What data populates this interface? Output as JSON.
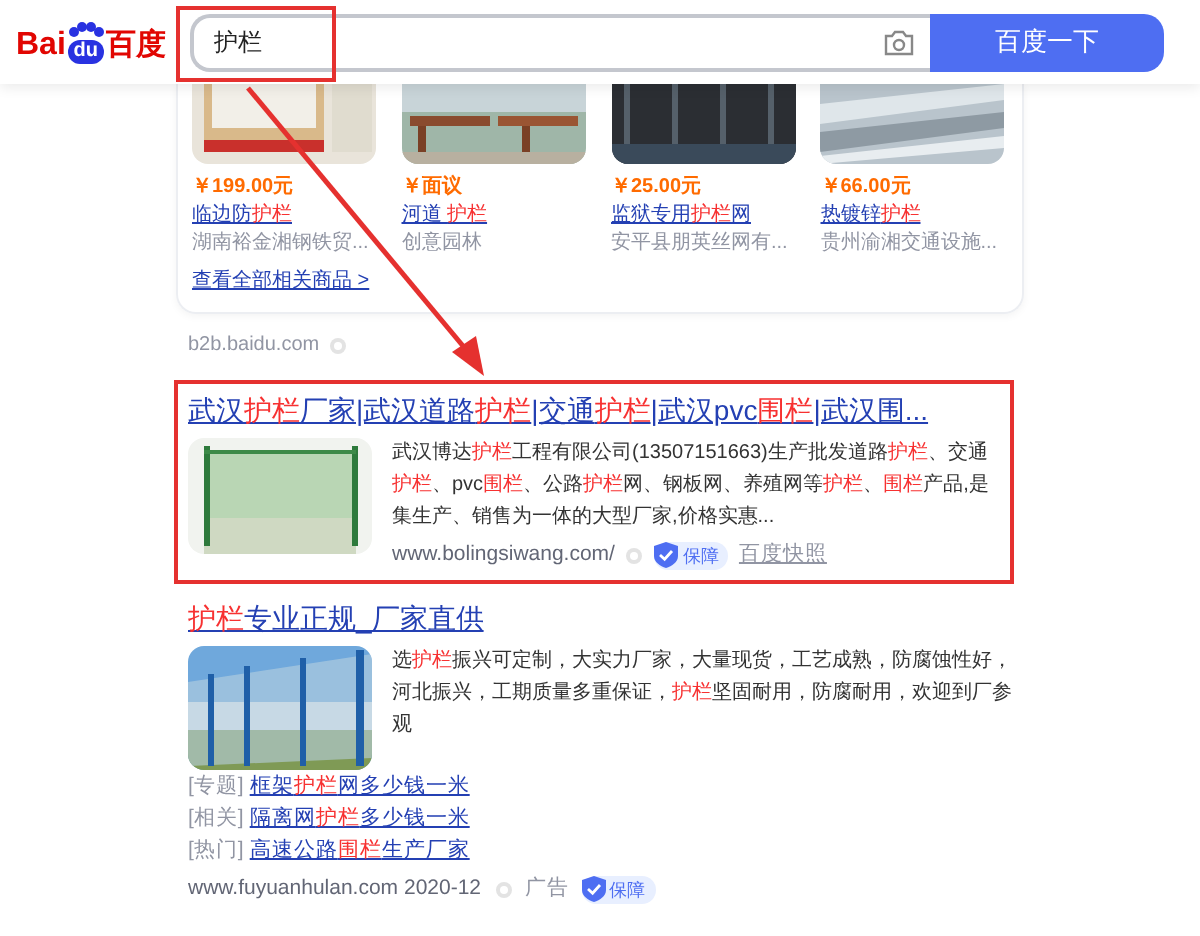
{
  "header": {
    "logo": {
      "latin": "Bai",
      "paw": "du",
      "chinese": "百度"
    },
    "search": {
      "value": "护栏"
    },
    "search_button": "百度一下"
  },
  "products": {
    "items": [
      {
        "price": "￥199.00元",
        "title": [
          {
            "text": "临边防",
            "highlight": false
          },
          {
            "text": "护栏",
            "highlight": true
          }
        ],
        "shop": "湖南裕金湘钢铁贸..."
      },
      {
        "price": "￥面议",
        "title": [
          {
            "text": "河道 ",
            "highlight": false
          },
          {
            "text": "护栏",
            "highlight": true
          }
        ],
        "shop": "创意园林"
      },
      {
        "price": "￥25.00元",
        "title": [
          {
            "text": "监狱专用",
            "highlight": false
          },
          {
            "text": "护栏",
            "highlight": true
          },
          {
            "text": "网",
            "highlight": false
          }
        ],
        "shop": "安平县朋英丝网有..."
      },
      {
        "price": "￥66.00元",
        "title": [
          {
            "text": "热镀锌",
            "highlight": false
          },
          {
            "text": "护栏",
            "highlight": true
          }
        ],
        "shop": "贵州渝湘交通设施..."
      }
    ],
    "more_link": "查看全部相关商品 >",
    "source": "b2b.baidu.com"
  },
  "results": [
    {
      "title": [
        {
          "text": "武汉",
          "highlight": false
        },
        {
          "text": "护栏",
          "highlight": true
        },
        {
          "text": "厂家|武汉道路",
          "highlight": false
        },
        {
          "text": "护栏",
          "highlight": true
        },
        {
          "text": "|交通",
          "highlight": false
        },
        {
          "text": "护栏",
          "highlight": true
        },
        {
          "text": "|武汉pvc",
          "highlight": false
        },
        {
          "text": "围栏",
          "highlight": true
        },
        {
          "text": "|武汉围...",
          "highlight": false
        }
      ],
      "description": [
        {
          "text": "武汉博达",
          "highlight": false
        },
        {
          "text": "护栏",
          "highlight": true
        },
        {
          "text": "工程有限公司(13507151663)生产批发道路",
          "highlight": false
        },
        {
          "text": "护栏",
          "highlight": true
        },
        {
          "text": "、交通",
          "highlight": false
        },
        {
          "text": "护栏",
          "highlight": true
        },
        {
          "text": "、pvc",
          "highlight": false
        },
        {
          "text": "围栏",
          "highlight": true
        },
        {
          "text": "、公路",
          "highlight": false
        },
        {
          "text": "护栏",
          "highlight": true
        },
        {
          "text": "网、钢板网、养殖网等",
          "highlight": false
        },
        {
          "text": "护栏",
          "highlight": true
        },
        {
          "text": "、",
          "highlight": false
        },
        {
          "text": "围栏",
          "highlight": true
        },
        {
          "text": "产品,是集生产、销售为一体的大型厂家,价格实惠...",
          "highlight": false
        }
      ],
      "url": "www.bolingsiwang.com/",
      "badge": "保障",
      "snapshot": "百度快照",
      "annotated": true
    },
    {
      "title": [
        {
          "text": "护栏",
          "highlight": true
        },
        {
          "text": "专业正规_厂家直供",
          "highlight": false
        }
      ],
      "description": [
        {
          "text": "选",
          "highlight": false
        },
        {
          "text": "护栏",
          "highlight": true
        },
        {
          "text": "振兴可定制，大实力厂家，大量现货，工艺成熟，防腐蚀性好，河北振兴，工期质量多重保证，",
          "highlight": false
        },
        {
          "text": "护栏",
          "highlight": true
        },
        {
          "text": "坚固耐用，防腐耐用，欢迎到厂参观",
          "highlight": false
        }
      ],
      "related": [
        {
          "label": "[专题]",
          "link": [
            {
              "text": "框架",
              "highlight": false
            },
            {
              "text": "护栏",
              "highlight": true
            },
            {
              "text": "网多少钱一米",
              "highlight": false
            }
          ]
        },
        {
          "label": "[相关]",
          "link": [
            {
              "text": "隔离网",
              "highlight": false
            },
            {
              "text": "护栏",
              "highlight": true
            },
            {
              "text": "多少钱一米",
              "highlight": false
            }
          ]
        },
        {
          "label": "[热门]",
          "link": [
            {
              "text": "高速公路",
              "highlight": false
            },
            {
              "text": "围栏",
              "highlight": true
            },
            {
              "text": "生产厂家",
              "highlight": false
            }
          ]
        }
      ],
      "url": "www.fuyuanhulan.com 2020-12",
      "ad": "广告",
      "badge": "保障",
      "annotated": false
    }
  ]
}
